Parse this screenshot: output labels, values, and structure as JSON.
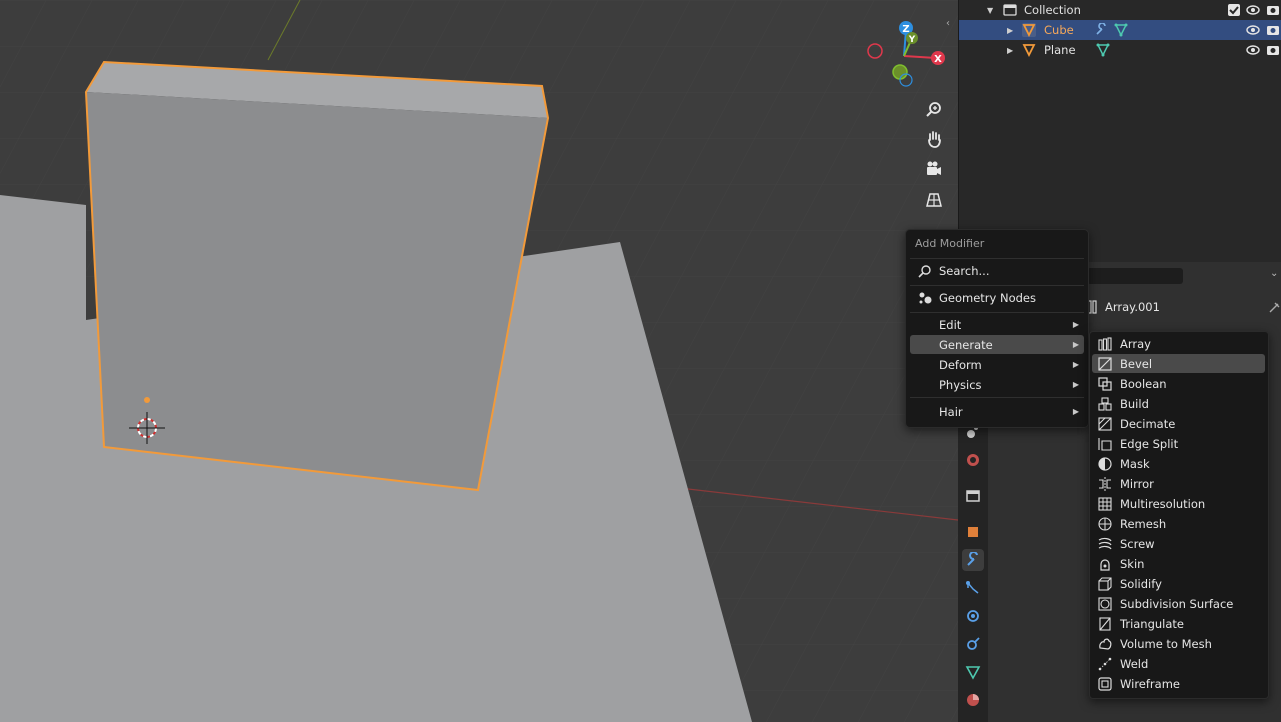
{
  "outliner": {
    "rows": [
      {
        "label": "Collection",
        "icon": "collection-icon"
      },
      {
        "label": "Cube",
        "icon": "mesh-object-icon",
        "modifiers": [
          "wrench-icon",
          "mesh-data-icon"
        ]
      },
      {
        "label": "Plane",
        "icon": "mesh-object-icon",
        "modifiers": [
          "mesh-data-icon"
        ]
      }
    ]
  },
  "properties": {
    "modifier_name": "Array.001"
  },
  "add_menu": {
    "title": "Add Modifier",
    "search_label": "Search...",
    "geometry_nodes_label": "Geometry Nodes",
    "items": [
      {
        "label": "Edit"
      },
      {
        "label": "Generate"
      },
      {
        "label": "Deform"
      },
      {
        "label": "Physics"
      },
      {
        "label": "Hair"
      }
    ]
  },
  "generate_menu": {
    "items": [
      {
        "label": "Array",
        "icon": "array-icon"
      },
      {
        "label": "Bevel",
        "icon": "bevel-icon"
      },
      {
        "label": "Boolean",
        "icon": "boolean-icon"
      },
      {
        "label": "Build",
        "icon": "build-icon"
      },
      {
        "label": "Decimate",
        "icon": "decimate-icon"
      },
      {
        "label": "Edge Split",
        "icon": "edge-split-icon"
      },
      {
        "label": "Mask",
        "icon": "mask-icon"
      },
      {
        "label": "Mirror",
        "icon": "mirror-icon"
      },
      {
        "label": "Multiresolution",
        "icon": "multires-icon"
      },
      {
        "label": "Remesh",
        "icon": "remesh-icon"
      },
      {
        "label": "Screw",
        "icon": "screw-icon"
      },
      {
        "label": "Skin",
        "icon": "skin-icon"
      },
      {
        "label": "Solidify",
        "icon": "solidify-icon"
      },
      {
        "label": "Subdivision Surface",
        "icon": "subsurf-icon"
      },
      {
        "label": "Triangulate",
        "icon": "triangulate-icon"
      },
      {
        "label": "Volume to Mesh",
        "icon": "volume-to-mesh-icon"
      },
      {
        "label": "Weld",
        "icon": "weld-icon"
      },
      {
        "label": "Wireframe",
        "icon": "wireframe-icon"
      }
    ]
  },
  "gizmo": {
    "z": "Z",
    "y": "Y",
    "x": "X"
  },
  "colors": {
    "selection_outline": "#f29a3a",
    "highlight_row": "#334d80",
    "x_axis": "#e0384c",
    "y_axis": "#7fbf2e",
    "z_axis": "#2d8fe0"
  }
}
